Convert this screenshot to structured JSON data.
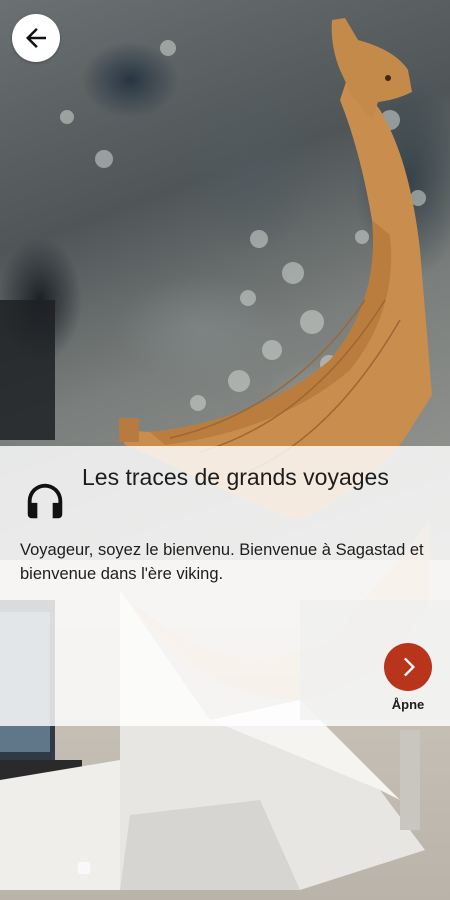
{
  "header": {
    "back_icon": "arrow-left-icon"
  },
  "panel": {
    "icon": "headphones-icon",
    "title": "Les traces de grands voyages",
    "description": "Voyageur, soyez le bienvenu. Bienvenue à Sagastad et bienvenue dans l'ère viking."
  },
  "action": {
    "open_label": "Åpne",
    "icon": "chevron-right-icon",
    "color": "#b8341b"
  }
}
